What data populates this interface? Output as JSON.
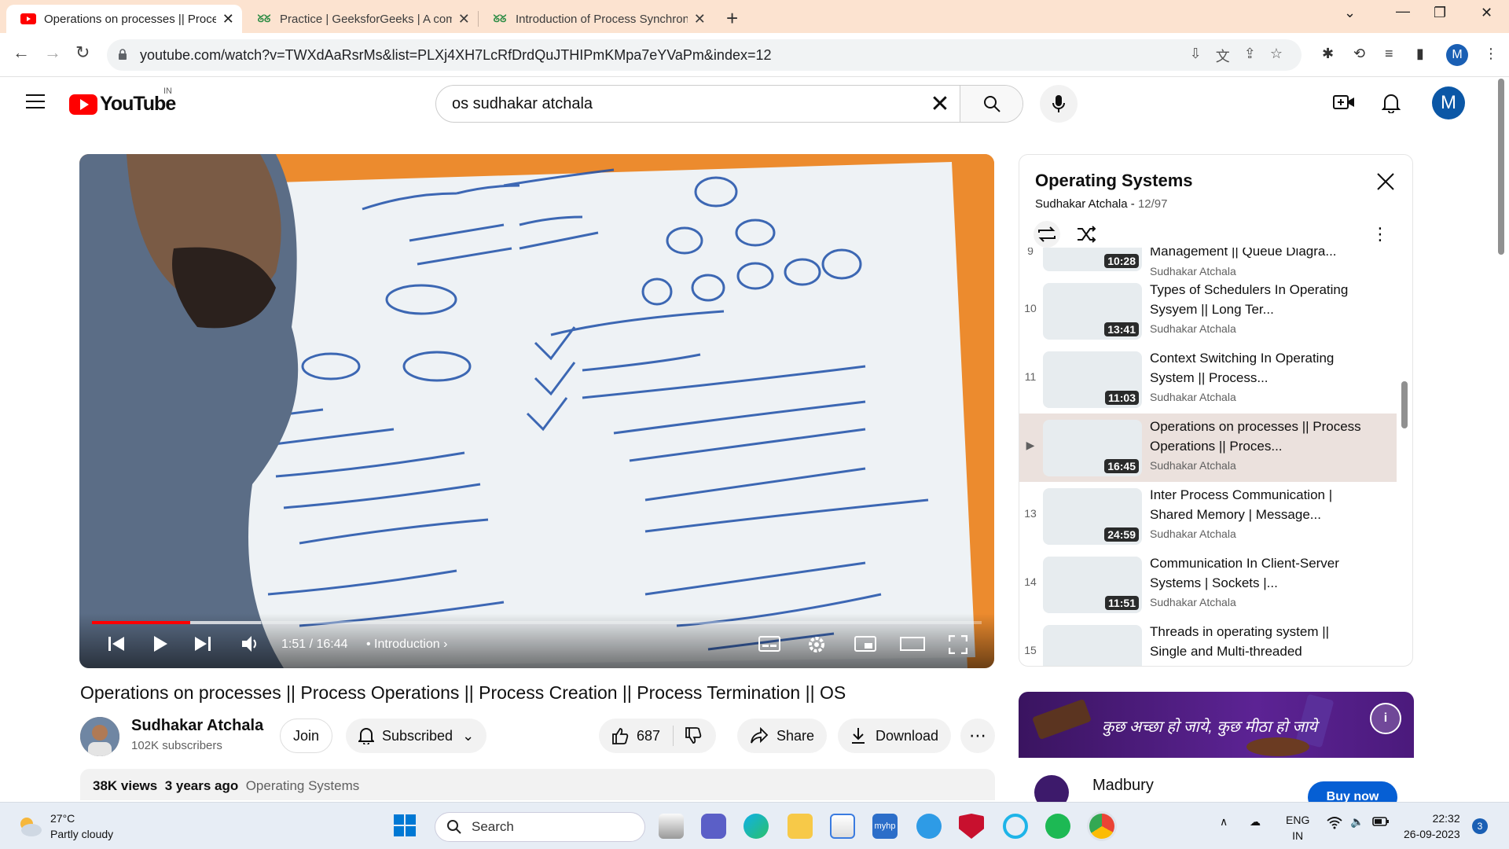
{
  "browser": {
    "tabs": [
      {
        "title": "Operations on processes || Proce",
        "active": true
      },
      {
        "title": "Practice | GeeksforGeeks | A com",
        "active": false
      },
      {
        "title": "Introduction of Process Synchron",
        "active": false
      }
    ],
    "url": "youtube.com/watch?v=TWXdAaRsrMs&list=PLXj4XH7LcRfDrdQuJTHIPmKMpa7eYVaPm&index=12",
    "profile_initial": "M"
  },
  "youtube": {
    "logo_text": "YouTube",
    "country_code": "IN",
    "search_query": "os sudhakar atchala",
    "avatar_initial": "M"
  },
  "video": {
    "time": "1:51 / 16:44",
    "chapter": "Introduction",
    "progress_played": 0.11,
    "progress_buffered": 0.19,
    "title": "Operations on processes || Process Operations || Process Creation || Process Termination || OS",
    "channel": "Sudhakar Atchala",
    "subscribers": "102K subscribers",
    "join_label": "Join",
    "subscribed_label": "Subscribed",
    "likes": "687",
    "share_label": "Share",
    "download_label": "Download",
    "views": "38K views",
    "age": "3 years ago",
    "description_tag": "Operating Systems"
  },
  "playlist": {
    "title": "Operating Systems",
    "owner": "Sudhakar Atchala",
    "position": "12/97",
    "items": [
      {
        "index": "9",
        "title": "Management || Queue Diagra...",
        "channel": "Sudhakar Atchala",
        "duration": "10:28",
        "current": false
      },
      {
        "index": "10",
        "title": "Types of Schedulers In Operating Sysyem || Long Ter...",
        "channel": "Sudhakar Atchala",
        "duration": "13:41",
        "current": false
      },
      {
        "index": "11",
        "title": "Context Switching In Operating System || Process...",
        "channel": "Sudhakar Atchala",
        "duration": "11:03",
        "current": false
      },
      {
        "index": "▶",
        "title": "Operations on processes || Process Operations || Proces...",
        "channel": "Sudhakar Atchala",
        "duration": "16:45",
        "current": true
      },
      {
        "index": "13",
        "title": "Inter Process Communication | Shared Memory | Message...",
        "channel": "Sudhakar Atchala",
        "duration": "24:59",
        "current": false
      },
      {
        "index": "14",
        "title": "Communication In Client-Server Systems | Sockets |...",
        "channel": "Sudhakar Atchala",
        "duration": "11:51",
        "current": false
      },
      {
        "index": "15",
        "title": "Threads in operating system || Single and Multi-threaded",
        "channel": "Sudhakar Atchala",
        "duration": "",
        "current": false
      }
    ]
  },
  "ad": {
    "tagline": "कुछ अच्छा हो जाये, कुछ मीठा हो जाये",
    "brand": "Madbury",
    "cta": "Buy now"
  },
  "taskbar": {
    "temperature": "27°C",
    "weather": "Partly cloudy",
    "search_placeholder": "Search",
    "lang": "ENG",
    "region": "IN",
    "time": "22:32",
    "date": "26-09-2023",
    "notifications": "3"
  }
}
